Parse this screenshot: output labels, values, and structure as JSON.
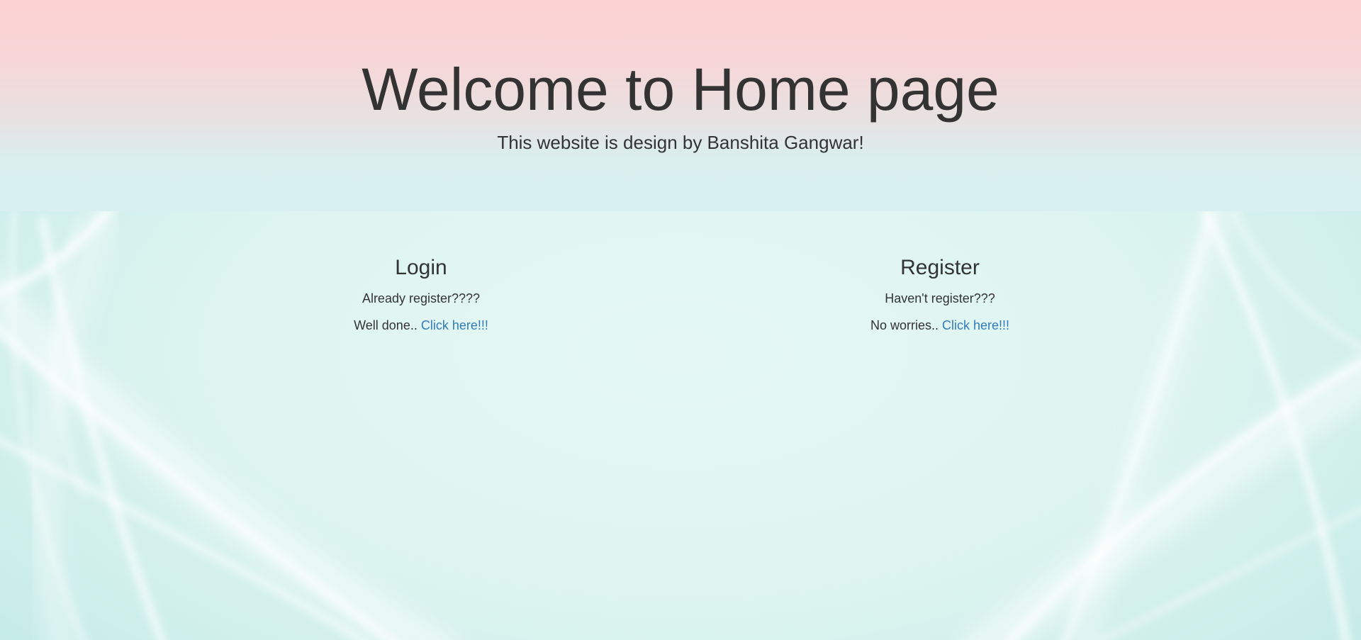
{
  "hero": {
    "title": "Welcome to Home page",
    "subtitle": "This website is design by Banshita Gangwar!"
  },
  "login": {
    "heading": "Login",
    "question": "Already register????",
    "prompt": "Well done..",
    "link_label": "Click here!!!"
  },
  "register": {
    "heading": "Register",
    "question": "Haven't register???",
    "prompt": "No worries..",
    "link_label": "Click here!!!"
  },
  "colors": {
    "text": "#333333",
    "link": "#337ab7",
    "hero_top": "#fcd1d2",
    "hero_bottom": "#d8f0f0",
    "background": "#dff5f1"
  }
}
